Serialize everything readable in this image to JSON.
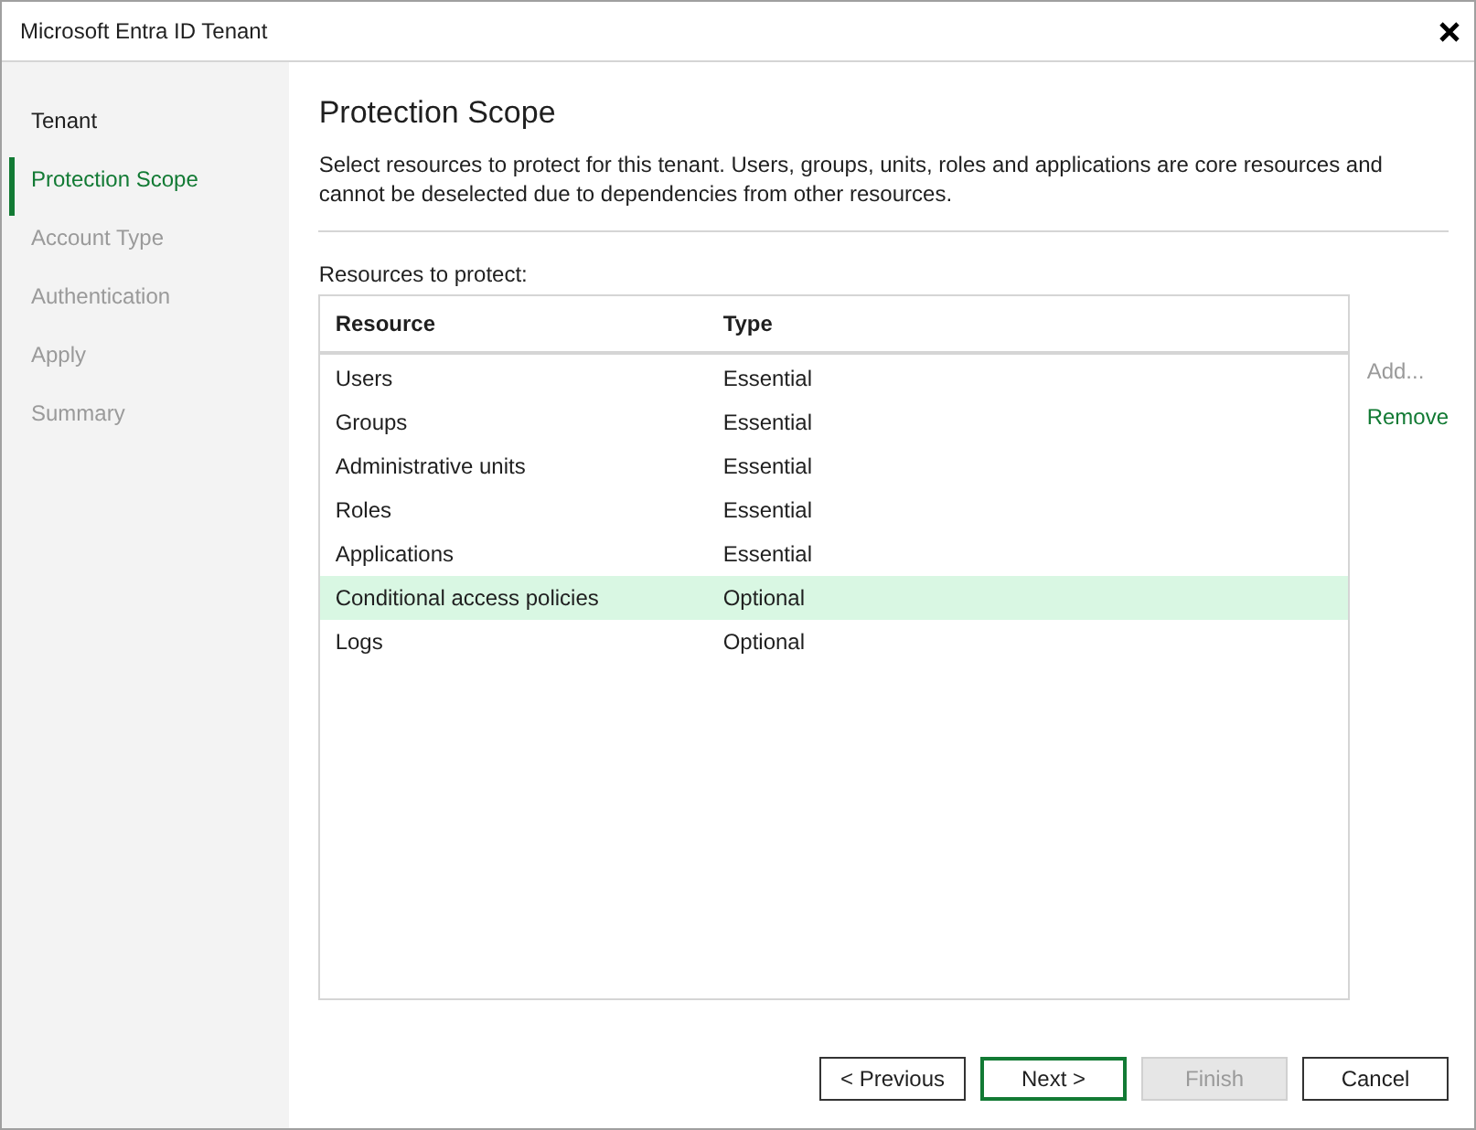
{
  "window": {
    "title": "Microsoft Entra ID Tenant"
  },
  "steps": [
    {
      "label": "Tenant",
      "selected": false,
      "disabled": false
    },
    {
      "label": "Protection Scope",
      "selected": true,
      "disabled": false
    },
    {
      "label": "Account Type",
      "selected": false,
      "disabled": true
    },
    {
      "label": "Authentication",
      "selected": false,
      "disabled": true
    },
    {
      "label": "Apply",
      "selected": false,
      "disabled": true
    },
    {
      "label": "Summary",
      "selected": false,
      "disabled": true
    }
  ],
  "page": {
    "heading": "Protection Scope",
    "description": "Select resources to protect for this tenant. Users, groups, units, roles and applications are core resources and cannot be deselected due to dependencies from other resources.",
    "list_label": "Resources to protect:"
  },
  "table": {
    "columns": [
      "Resource",
      "Type"
    ],
    "rows": [
      {
        "resource": "Users",
        "type": "Essential",
        "selected": false
      },
      {
        "resource": "Groups",
        "type": "Essential",
        "selected": false
      },
      {
        "resource": "Administrative units",
        "type": "Essential",
        "selected": false
      },
      {
        "resource": "Roles",
        "type": "Essential",
        "selected": false
      },
      {
        "resource": "Applications",
        "type": "Essential",
        "selected": false
      },
      {
        "resource": "Conditional access policies",
        "type": "Optional",
        "selected": true
      },
      {
        "resource": "Logs",
        "type": "Optional",
        "selected": false
      }
    ]
  },
  "side_actions": [
    {
      "label": "Add...",
      "disabled": true
    },
    {
      "label": "Remove",
      "disabled": false
    }
  ],
  "buttons": [
    {
      "label": "< Previous",
      "default": false,
      "disabled": false
    },
    {
      "label": "Next >",
      "default": true,
      "disabled": false
    },
    {
      "label": "Finish",
      "default": false,
      "disabled": true
    },
    {
      "label": "Cancel",
      "default": false,
      "disabled": false
    }
  ]
}
